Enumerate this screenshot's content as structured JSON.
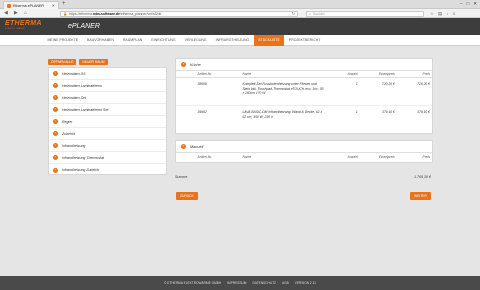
{
  "browser": {
    "tab_title": "Etherma ePLANER",
    "url_prefix": "https://etherma.",
    "url_host": "mbs-software.de",
    "url_path": "/etherma_planner/ver/s5/de",
    "search_placeholder": "Suchen"
  },
  "header": {
    "brand": "ETHERMA",
    "claim": "SIMPLY WARM",
    "app_name": "ePLANER"
  },
  "menu": [
    "MEINE PROJEKTE",
    "BAUVORHABEN",
    "RAUMPLAN",
    "EINRICHTUNG",
    "VERLEGUNG",
    "INFRAROTHEIZUNG",
    "STÜCKLISTE",
    "PROJEKTBERICHT"
  ],
  "left": {
    "btn_open_all": "ÖFFNEN ALLE",
    "btn_new_room": "NEUER RAUM",
    "items": [
      "Heizmatten DS",
      "Heizmatten Laminattherm",
      "Heizmatten Set",
      "Heizmatten Laminattherm Set",
      "Regler",
      "Zubehör",
      "Infrarotheizung",
      "Infrarotheizung Thermostat",
      "Infrarotheizung Zubehör"
    ]
  },
  "rooms": [
    {
      "name": "Küche",
      "headers": [
        "",
        "Artikel-Nr.",
        "Name",
        "Anzahl",
        "Einzelpreis",
        "Preis"
      ],
      "rows": [
        {
          "art": "38608",
          "name": "Komplett-Set Fussbodenheizung unter Fliesen und Stein inkl. Touchpad-Thermostat eTOUCH-eco, 1m², 50 x 160cm 170 W",
          "qty": "1",
          "unit": "720,20 €",
          "price": "720,20 €"
        },
        {
          "art": "39992",
          "name": "LAVA BASIC-DM Infrarotheizung, Wand & Decke, 62 x 62 cm, 350 W, 230 V",
          "qty": "1",
          "unit": "379,10 €",
          "price": "379,10 €"
        }
      ]
    },
    {
      "name": "Manuell",
      "headers": [
        "",
        "Artikel-Nr.",
        "Name",
        "Anzahl",
        "Einzelpreis",
        "Preis"
      ],
      "rows": []
    }
  ],
  "summary": {
    "label": "Summe",
    "value": "1.765,30 €"
  },
  "actions": {
    "back": "ZURÜCK",
    "next": "WEITER"
  },
  "footer": [
    "© ETHERMA ELEKTROWÄRME GMBH",
    "IMPRESSUM",
    "DATENSCHUTZ",
    "AGB",
    "VERSION 2.11"
  ],
  "colors": {
    "accent": "#e8731a",
    "header_bg": "#3d3d3d",
    "footer_bg": "#4a4a4a"
  }
}
